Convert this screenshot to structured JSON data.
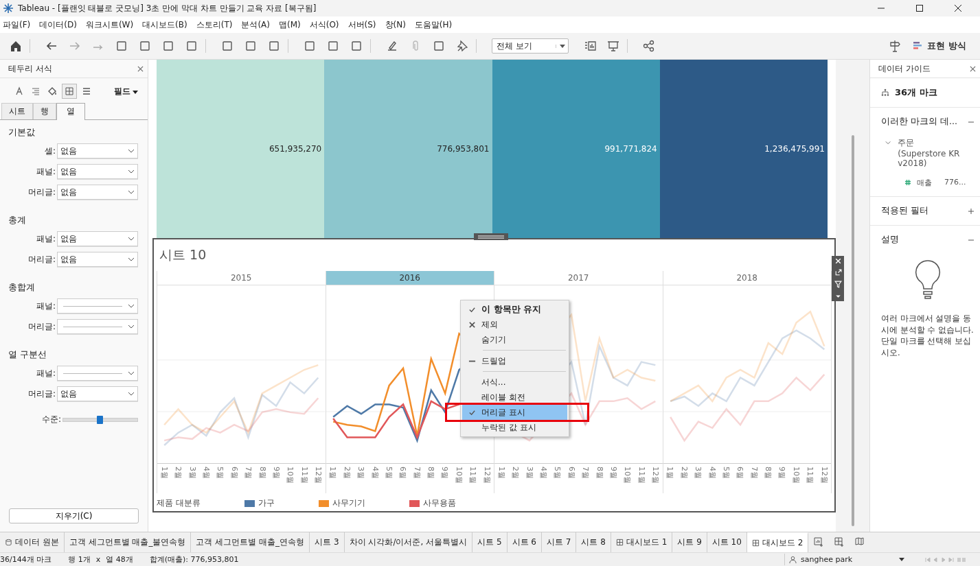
{
  "window": {
    "title": "Tableau - [플랜잇 태블로 굿모닝] 3초 만에 막대 차트 만들기 교육 자료 [복구됨]"
  },
  "menu": [
    "파일(F)",
    "데이터(D)",
    "워크시트(W)",
    "대시보드(B)",
    "스토리(T)",
    "분석(A)",
    "맵(M)",
    "서식(O)",
    "서버(S)",
    "창(N)",
    "도움말(H)"
  ],
  "toolbar": {
    "view_select": "전체 보기",
    "show_me": "표현 방식"
  },
  "format_pane": {
    "title": "테두리 서식",
    "field_button": "필드",
    "tabs": [
      {
        "label": "시트",
        "selected": false
      },
      {
        "label": "행",
        "selected": false
      },
      {
        "label": "열",
        "selected": true
      }
    ],
    "sections": [
      {
        "title": "기본값",
        "rows": [
          {
            "label": "셀:",
            "kind": "value",
            "value": "없음"
          },
          {
            "label": "패널:",
            "kind": "value",
            "value": "없음"
          },
          {
            "label": "머리글:",
            "kind": "value",
            "value": "없음"
          }
        ]
      },
      {
        "title": "총계",
        "rows": [
          {
            "label": "패널:",
            "kind": "value",
            "value": "없음"
          },
          {
            "label": "머리글:",
            "kind": "value",
            "value": "없음"
          }
        ]
      },
      {
        "title": "총합계",
        "rows": [
          {
            "label": "패널:",
            "kind": "line"
          },
          {
            "label": "머리글:",
            "kind": "line"
          }
        ]
      },
      {
        "title": "열 구분선",
        "rows": [
          {
            "label": "패널:",
            "kind": "line"
          },
          {
            "label": "머리글:",
            "kind": "value",
            "value": "없음"
          }
        ]
      }
    ],
    "slider": {
      "label": "수준:",
      "level": 0.5
    },
    "clear_button": "지우기(C)"
  },
  "top_viz": {
    "cells": [
      {
        "value": "651,935,270",
        "color": "#bde3d9"
      },
      {
        "value": "776,953,801",
        "color": "#8cc6cd"
      },
      {
        "value": "991,771,824",
        "color": "#3c95b0"
      },
      {
        "value": "1,236,475,991",
        "color": "#2d5a87"
      }
    ]
  },
  "sheet": {
    "title": "시트 10",
    "years": [
      {
        "label": "2015",
        "selected": false,
        "months": [
          "1월",
          "2월",
          "3월",
          "4월",
          "5월",
          "6월",
          "7월",
          "8월",
          "9월",
          "10월",
          "11월",
          "12월"
        ]
      },
      {
        "label": "2016",
        "selected": true,
        "months": [
          "1월",
          "2월",
          "3월",
          "4월",
          "5월",
          "6월",
          "7월",
          "8월",
          "9월",
          "10월",
          "11월",
          "12월"
        ]
      },
      {
        "label": "2017",
        "selected": false,
        "months": [
          "1월",
          "2월",
          "3월",
          "4월",
          "5월",
          "6월",
          "7월",
          "8월",
          "9월",
          "10월",
          "11월",
          "12월"
        ]
      },
      {
        "label": "2018",
        "selected": false,
        "months": [
          "1월",
          "2월",
          "3월",
          "4월",
          "5월",
          "6월",
          "7월",
          "8월",
          "9월",
          "10월",
          "11월",
          "12월"
        ]
      }
    ],
    "legend": {
      "title": "제품 대분류",
      "items": [
        {
          "label": "가구",
          "color": "#4e79a7"
        },
        {
          "label": "사무기기",
          "color": "#f28e2b"
        },
        {
          "label": "사무용품",
          "color": "#e15759"
        }
      ]
    }
  },
  "context_menu": {
    "groups": [
      [
        {
          "label": "이 항목만 유지",
          "kind": "check",
          "bold": true,
          "selected": false
        },
        {
          "label": "제외",
          "kind": "x",
          "bold": false,
          "selected": false
        },
        {
          "label": "숨기기",
          "kind": "none",
          "bold": false,
          "selected": false
        }
      ],
      [
        {
          "label": "드릴업",
          "kind": "dash",
          "bold": false,
          "selected": false
        }
      ],
      [
        {
          "label": "서식...",
          "kind": "none",
          "bold": false,
          "selected": false
        },
        {
          "label": "레이블 회전",
          "kind": "none",
          "bold": false,
          "selected": false
        },
        {
          "label": "머리글 표시",
          "kind": "check",
          "bold": false,
          "selected": true
        },
        {
          "label": "누락된 값 표시",
          "kind": "none",
          "bold": false,
          "selected": false
        }
      ]
    ]
  },
  "data_guide": {
    "title": "데이터 가이드",
    "marks": "36개 마크",
    "section_marks": "이러한 마크의 데...",
    "source": "주문\n(Superstore KR v2018)",
    "field": "매출",
    "field_value": "776...",
    "filters": "적용된 필터",
    "description": "설명",
    "note": "여러 마크에서 설명을 동시에 분석할 수 없습니다. 단일 마크를 선택해 보십시오."
  },
  "sheet_tabs": [
    {
      "label": "데이터 원본",
      "kind": "datasource",
      "selected": false
    },
    {
      "label": "고객 세그먼트별 매출_불연속형",
      "kind": "sheet",
      "selected": false
    },
    {
      "label": "고객 세그먼트별 매출_연속형",
      "kind": "sheet",
      "selected": false
    },
    {
      "label": "시트 3",
      "kind": "sheet",
      "selected": false
    },
    {
      "label": "차이 시각화/이서준, 서울특별시",
      "kind": "sheet",
      "selected": false
    },
    {
      "label": "시트 5",
      "kind": "sheet",
      "selected": false
    },
    {
      "label": "시트 6",
      "kind": "sheet",
      "selected": false
    },
    {
      "label": "시트 7",
      "kind": "sheet",
      "selected": false
    },
    {
      "label": "시트 8",
      "kind": "sheet",
      "selected": false
    },
    {
      "label": "대시보드 1",
      "kind": "dashboard",
      "selected": false
    },
    {
      "label": "시트 9",
      "kind": "sheet",
      "selected": false
    },
    {
      "label": "시트 10",
      "kind": "sheet",
      "selected": false
    },
    {
      "label": "대시보드 2",
      "kind": "dashboard",
      "selected": true
    }
  ],
  "status_bar": {
    "marks": "36/144개 마크",
    "rows": "행 1개",
    "times": "x",
    "cols": "열 48개",
    "sum": "합계(매출): 776,953,801",
    "user": "sanghee park"
  }
}
